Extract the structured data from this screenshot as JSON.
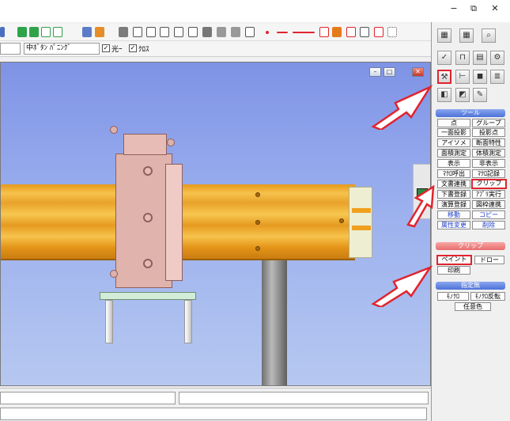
{
  "window": {
    "minimize_glyph": "−",
    "restore_glyph": "⧉",
    "close_glyph": "✕"
  },
  "toolbar2": {
    "combo1_value": "",
    "combo2_value": "中ﾎﾞﾀﾝ ﾊﾟﾆﾝｸﾞ",
    "check1_label": "光ｰ",
    "check2_label": "ｸﾛｽ"
  },
  "viewport_buttons": {
    "minimize": "–",
    "restore": "□",
    "close": "✕"
  },
  "right_panel": {
    "tools_header": "ツール",
    "tool_buttons": [
      [
        "点",
        "グループ"
      ],
      [
        "一面投影",
        "投影点"
      ],
      [
        "アイソメ",
        "断面特性"
      ],
      [
        "面積測定",
        "体積測定"
      ],
      [
        "表示",
        "非表示"
      ],
      [
        "ﾏｸﾛ呼出",
        "ﾏｸﾛ記録"
      ],
      [
        "文書連携",
        "クリップ"
      ],
      [
        "下書登録",
        "ｱﾌﾟﾘ実行"
      ],
      [
        "演算登録",
        "図枠連携"
      ],
      [
        "移動",
        "コピー"
      ],
      [
        "属性変更",
        "削除"
      ]
    ],
    "clip_header": "クリップ",
    "paint_button": "ペイント",
    "draw_button": "ドロー",
    "print_button": "印刷",
    "unspecified_header": "指定無",
    "mono_button": "ﾓﾉｸﾛ",
    "mono_invert_button": "ﾓﾉｸﾛ反転",
    "any_color_button": "任意色"
  },
  "colors": {
    "highlight": "#e0242e",
    "panel_header_blue": "#4d71d8",
    "panel_header_red": "#e86c6c",
    "beam_orange": "#e9a22a",
    "viewport_blue": "#9bb0ee"
  }
}
